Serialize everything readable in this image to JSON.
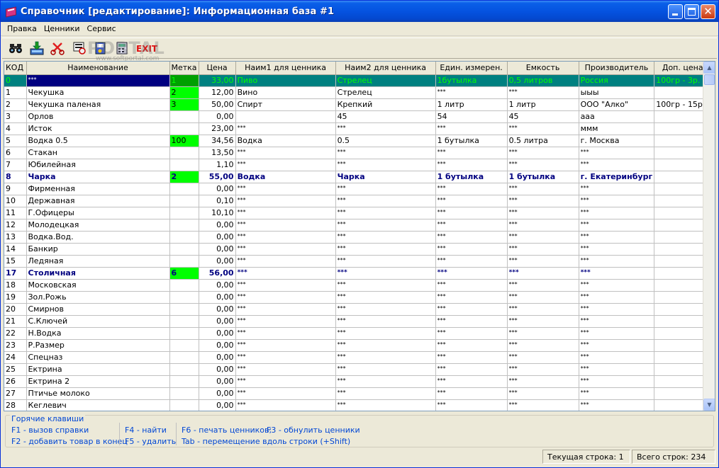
{
  "window": {
    "title": "Справочник [редактирование]: Информационная база #1"
  },
  "menu": [
    "Правка",
    "Ценники",
    "Сервис"
  ],
  "toolbar": {
    "buttons": [
      {
        "name": "find-binoculars-icon"
      },
      {
        "name": "import-download-icon"
      },
      {
        "name": "cut-scissors-icon"
      },
      {
        "name": "print-preview-icon"
      },
      {
        "name": "help-book-icon"
      },
      {
        "name": "calculator-icon"
      },
      {
        "name": "exit-icon",
        "label": "EXIT"
      }
    ],
    "watermark": "PORTAL",
    "watermark_url": "www.softportal.com"
  },
  "grid": {
    "columns": [
      "КОД",
      "Наименование",
      "Метка",
      "Цена",
      "Наим1 для ценника",
      "Наим2 для ценника",
      "Един. измерен.",
      "Емкость",
      "Производитель",
      "Доп. цена"
    ],
    "rows": [
      [
        "0",
        "***",
        "1",
        "33,00",
        "Пиво",
        "Стрелец",
        "1бутылка",
        "0,5 литров",
        "Россия",
        "100гр - 3р."
      ],
      [
        "1",
        "Чекушка",
        "2",
        "12,00",
        "Вино",
        "Стрелец",
        "***",
        "***",
        "ыыы",
        ""
      ],
      [
        "2",
        "Чекушка паленая",
        "3",
        "50,00",
        "Спирт",
        "Крепкий",
        "1 литр",
        "1 литр",
        "ООО \"Алко\"",
        "100гр - 15р."
      ],
      [
        "3",
        "Орлов",
        "",
        "0,00",
        "",
        "45",
        "54",
        "45",
        "ааа",
        ""
      ],
      [
        "4",
        "Исток",
        "",
        "23,00",
        "***",
        "***",
        "***",
        "***",
        "ммм",
        ""
      ],
      [
        "5",
        "Водка 0.5",
        "100",
        "34,56",
        "Водка",
        "0.5",
        "1 бутылка",
        "0.5 литра",
        "г. Москва",
        ""
      ],
      [
        "6",
        "Стакан",
        "",
        "13,50",
        "***",
        "***",
        "***",
        "***",
        "***",
        ""
      ],
      [
        "7",
        "Юбилейная",
        "",
        "1,10",
        "***",
        "***",
        "***",
        "***",
        "***",
        ""
      ],
      [
        "8",
        "Чарка",
        "2",
        "55,00",
        "Водка",
        "Чарка",
        "1 бутылка",
        "1 бутылка",
        "г. Екатеринбург",
        ""
      ],
      [
        "9",
        "Фирменная",
        "",
        "0,00",
        "***",
        "***",
        "***",
        "***",
        "***",
        ""
      ],
      [
        "10",
        "Державная",
        "",
        "0,10",
        "***",
        "***",
        "***",
        "***",
        "***",
        ""
      ],
      [
        "11",
        "Г.Офицеры",
        "",
        "10,10",
        "***",
        "***",
        "***",
        "***",
        "***",
        ""
      ],
      [
        "12",
        "Молодецкая",
        "",
        "0,00",
        "***",
        "***",
        "***",
        "***",
        "***",
        ""
      ],
      [
        "13",
        "Водка.Вод.",
        "",
        "0,00",
        "***",
        "***",
        "***",
        "***",
        "***",
        ""
      ],
      [
        "14",
        "Банкир",
        "",
        "0,00",
        "***",
        "***",
        "***",
        "***",
        "***",
        ""
      ],
      [
        "15",
        "Ледяная",
        "",
        "0,00",
        "***",
        "***",
        "***",
        "***",
        "***",
        ""
      ],
      [
        "17",
        "Столичная",
        "6",
        "56,00",
        "***",
        "***",
        "***",
        "***",
        "***",
        ""
      ],
      [
        "18",
        "Московская",
        "",
        "0,00",
        "***",
        "***",
        "***",
        "***",
        "***",
        ""
      ],
      [
        "19",
        "Зол.Рожь",
        "",
        "0,00",
        "***",
        "***",
        "***",
        "***",
        "***",
        ""
      ],
      [
        "20",
        "Смирнов",
        "",
        "0,00",
        "***",
        "***",
        "***",
        "***",
        "***",
        ""
      ],
      [
        "21",
        "С.Ключей",
        "",
        "0,00",
        "***",
        "***",
        "***",
        "***",
        "***",
        ""
      ],
      [
        "22",
        "Н.Водка",
        "",
        "0,00",
        "***",
        "***",
        "***",
        "***",
        "***",
        ""
      ],
      [
        "23",
        "Р.Размер",
        "",
        "0,00",
        "***",
        "***",
        "***",
        "***",
        "***",
        ""
      ],
      [
        "24",
        "Спецназ",
        "",
        "0,00",
        "***",
        "***",
        "***",
        "***",
        "***",
        ""
      ],
      [
        "25",
        "Ектрина",
        "",
        "0,00",
        "***",
        "***",
        "***",
        "***",
        "***",
        ""
      ],
      [
        "26",
        "Ектрина 2",
        "",
        "0,00",
        "***",
        "***",
        "***",
        "***",
        "***",
        ""
      ],
      [
        "27",
        "Птичье молоко",
        "",
        "0,00",
        "***",
        "***",
        "***",
        "***",
        "***",
        ""
      ],
      [
        "28",
        "Кеглевич",
        "",
        "0,00",
        "***",
        "***",
        "***",
        "***",
        "***",
        ""
      ]
    ],
    "selected_row": 0,
    "bold_rows": [
      8,
      16
    ],
    "colors": {
      "selection": "#008080",
      "mark": "#00ff00",
      "bold_text": "#000080"
    }
  },
  "hotkeys": {
    "title": "Горячие клавиши",
    "items": [
      "F1 - вызов справки",
      "F2 - добавить товар в конец",
      "F4 - найти",
      "F5 - удалить",
      "F6 - печать ценников;",
      "F3 - обнулить ценники",
      "Tab - перемещение вдоль строки (+Shift)"
    ]
  },
  "status": {
    "current_row_label": "Текущая строка:",
    "current_row": "1",
    "total_rows_label": "Всего строк:",
    "total_rows": "234"
  }
}
